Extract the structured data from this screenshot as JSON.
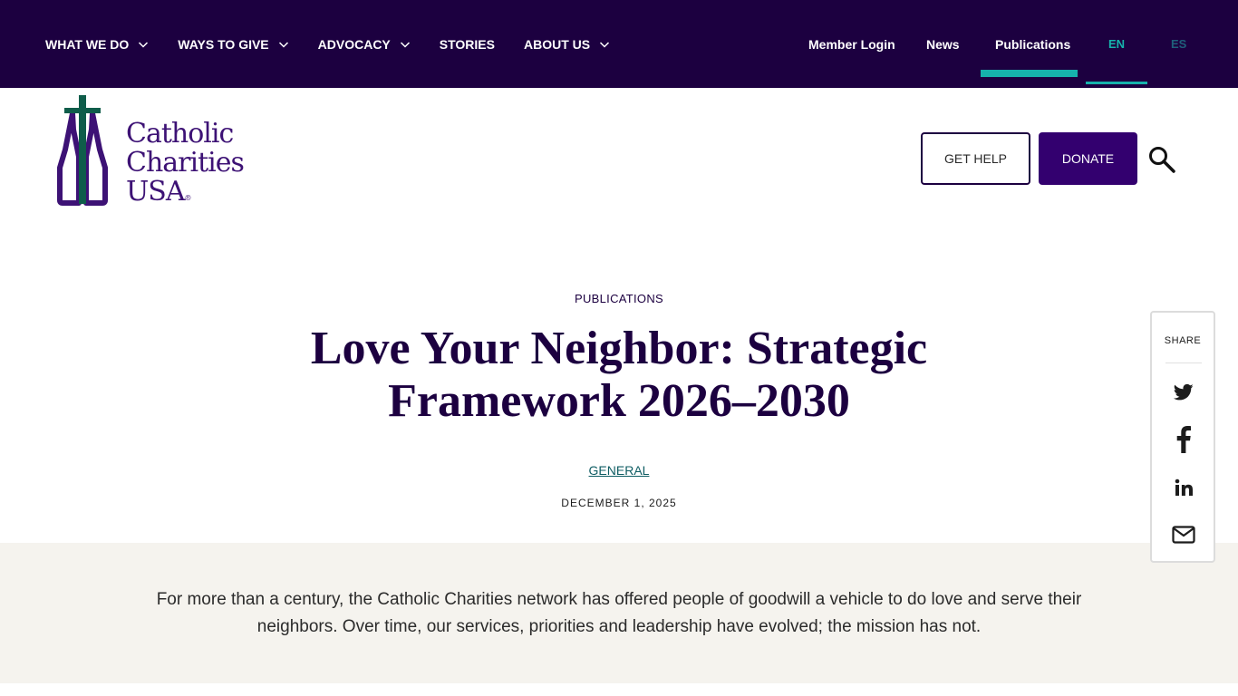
{
  "topnav": {
    "items": [
      {
        "label": "WHAT WE DO",
        "has_dropdown": true
      },
      {
        "label": "WAYS TO GIVE",
        "has_dropdown": true
      },
      {
        "label": "ADVOCACY",
        "has_dropdown": true
      },
      {
        "label": "STORIES",
        "has_dropdown": false
      },
      {
        "label": "ABOUT US",
        "has_dropdown": true
      }
    ],
    "utility": {
      "member_login": "Member Login",
      "news": "News",
      "publications": "Publications",
      "active": "Publications"
    },
    "languages": {
      "en": "EN",
      "es": "ES",
      "active": "EN"
    }
  },
  "logo": {
    "line1": "Catholic",
    "line2": "Charities",
    "line3": "USA",
    "reg": "®"
  },
  "header": {
    "get_help": "GET HELP",
    "donate": "DONATE"
  },
  "article": {
    "eyebrow": "PUBLICATIONS",
    "title": "Love Your Neighbor: Strategic Framework 2026–2030",
    "category": "GENERAL",
    "date": "DECEMBER 1, 2025",
    "intro": "For more than a century, the Catholic Charities network has offered people of goodwill a vehicle to do love and serve their neighbors. Over time, our services, priorities and leadership have evolved; the mission has not."
  },
  "share": {
    "label": "SHARE",
    "icons": [
      "twitter-icon",
      "facebook-icon",
      "linkedin-icon",
      "email-icon"
    ]
  },
  "colors": {
    "nav_bg": "#1c0040",
    "accent_teal": "#16b2ac",
    "brand_purple": "#33006f",
    "logo_green": "#0f5d4a",
    "intro_bg": "#f5f3ee"
  }
}
